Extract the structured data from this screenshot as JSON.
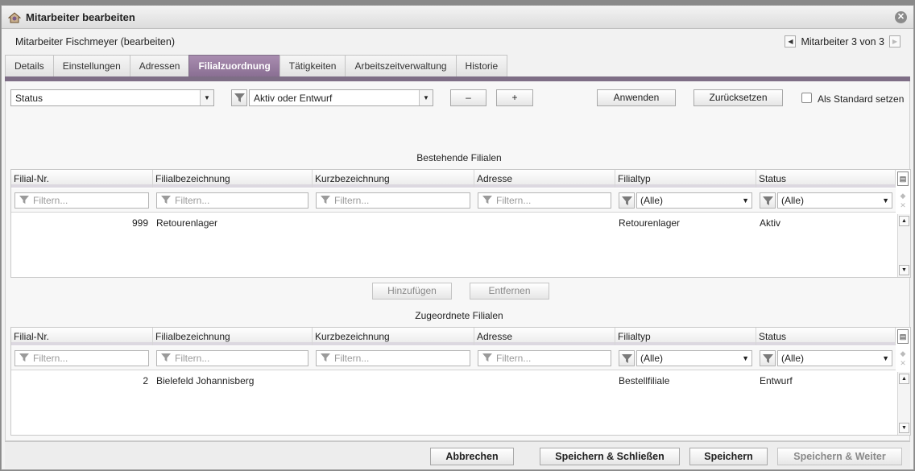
{
  "window": {
    "title": "Mitarbeiter bearbeiten",
    "app_icon": "user-edit-icon",
    "close_icon": "close-icon"
  },
  "subtitle": "Mitarbeiter Fischmeyer (bearbeiten)",
  "pager": {
    "text": "Mitarbeiter 3 von 3"
  },
  "tabs": [
    {
      "label": "Details"
    },
    {
      "label": "Einstellungen"
    },
    {
      "label": "Adressen"
    },
    {
      "label": "Filialzuordnung",
      "active": true
    },
    {
      "label": "Tätigkeiten"
    },
    {
      "label": "Arbeitszeitverwaltung"
    },
    {
      "label": "Historie"
    }
  ],
  "toolbar": {
    "field_select": "Status",
    "value_select": "Aktiv oder Entwurf",
    "minus_label": "–",
    "plus_label": "+",
    "apply_label": "Anwenden",
    "reset_label": "Zurücksetzen",
    "default_label": "Als Standard setzen",
    "default_checked": false
  },
  "existing": {
    "title": "Bestehende Filialen",
    "columns": [
      "Filial-Nr.",
      "Filialbezeichnung",
      "Kurzbezeichnung",
      "Adresse",
      "Filialtyp",
      "Status"
    ],
    "filter_placeholder": "Filtern...",
    "filter_all": "(Alle)",
    "rows": [
      {
        "nr": "999",
        "name": "Retourenlager",
        "short": "",
        "address": "",
        "type": "Retourenlager",
        "status": "Aktiv"
      }
    ]
  },
  "actions": {
    "add_label": "Hinzufügen",
    "remove_label": "Entfernen"
  },
  "assigned": {
    "title": "Zugeordnete Filialen",
    "columns": [
      "Filial-Nr.",
      "Filialbezeichnung",
      "Kurzbezeichnung",
      "Adresse",
      "Filialtyp",
      "Status"
    ],
    "filter_placeholder": "Filtern...",
    "filter_all": "(Alle)",
    "rows": [
      {
        "nr": "2",
        "name": "Bielefeld Johannisberg",
        "short": "",
        "address": "",
        "type": "Bestellfiliale",
        "status": "Entwurf"
      }
    ]
  },
  "footer": {
    "cancel_label": "Abbrechen",
    "save_close_label": "Speichern & Schließen",
    "save_label": "Speichern",
    "save_next_label": "Speichern & Weiter"
  },
  "colors": {
    "active_tab": "#8a6f93",
    "tab_strip": "#7e6e86"
  }
}
